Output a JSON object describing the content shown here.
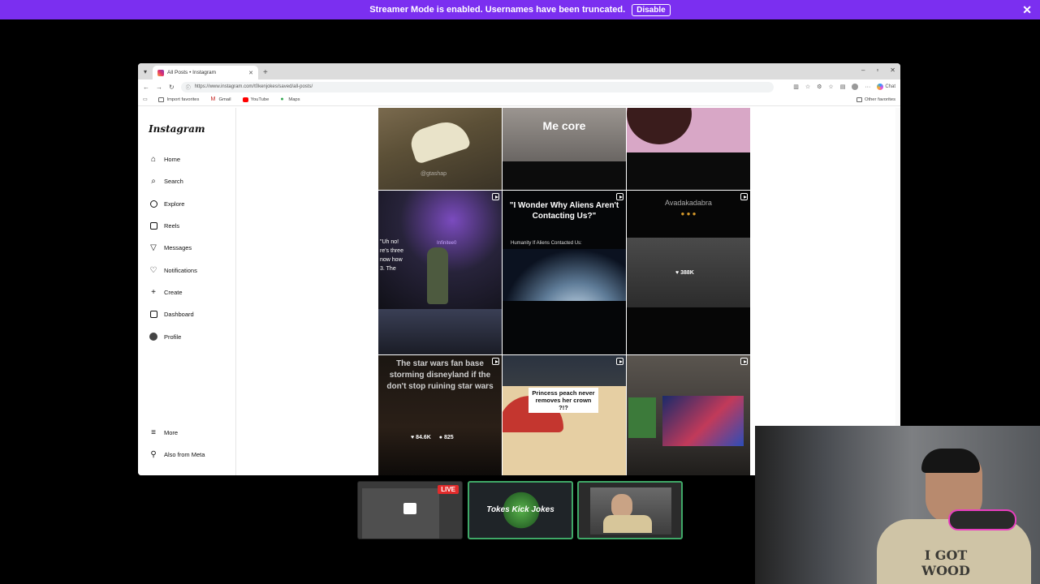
{
  "banner": {
    "message": "Streamer Mode is enabled. Usernames have been truncated.",
    "disable_label": "Disable",
    "close_glyph": "✕"
  },
  "browser": {
    "tab_title": "All Posts • Instagram",
    "new_tab_glyph": "+",
    "url": "https://www.instagram.com/t0kenjokes/saved/all-posts/",
    "copilot_label": "Chat",
    "favorites": [
      "Import favorites",
      "Gmail",
      "YouTube",
      "Maps"
    ],
    "other_favorites": "Other favorites"
  },
  "instagram": {
    "logo": "Instagram",
    "nav": [
      {
        "label": "Home",
        "icon": "home-icon"
      },
      {
        "label": "Search",
        "icon": "search-icon"
      },
      {
        "label": "Explore",
        "icon": "compass-icon"
      },
      {
        "label": "Reels",
        "icon": "reels-icon"
      },
      {
        "label": "Messages",
        "icon": "send-icon"
      },
      {
        "label": "Notifications",
        "icon": "heart-icon"
      },
      {
        "label": "Create",
        "icon": "plus-icon"
      },
      {
        "label": "Dashboard",
        "icon": "dashboard-icon"
      },
      {
        "label": "Profile",
        "icon": "avatar-icon"
      }
    ],
    "more": "More",
    "also_from_meta": "Also from Meta"
  },
  "posts": {
    "p1_watermark": "@gtashap",
    "p2_caption": "Me core",
    "p4_lines": [
      "\"Uh no!",
      "re's three",
      "now how",
      "3. The"
    ],
    "p4_handle": "Infinitee0",
    "p5_caption": "\"I Wonder Why Aliens Aren't Contacting Us?\"",
    "p5_sub": "Humanity If Aliens Contacted Us:",
    "p6_caption": "Avadakadabra",
    "p6_likes": "388K",
    "p7_caption": "The star wars fan base storming disneyland if the don't stop ruining star wars",
    "p7_likes": "84.6K",
    "p7_comments": "825",
    "p8_caption": "Princess peach never removes her crown ?!?"
  },
  "stream": {
    "live_label": "LIVE",
    "logo_text": "Tokes Kick Jokes"
  }
}
